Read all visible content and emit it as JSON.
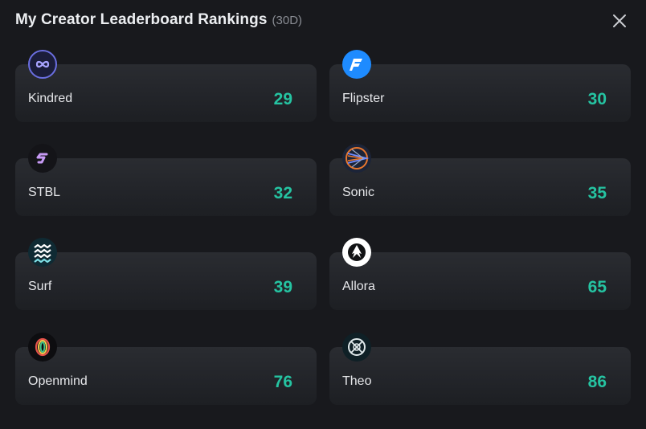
{
  "header": {
    "title": "My Creator Leaderboard Rankings",
    "period": "(30D)"
  },
  "close_icon": "close-icon",
  "colors": {
    "background": "#18191d",
    "card": "#26282d",
    "rank": "#25c4a2"
  },
  "rankings": [
    {
      "name": "Kindred",
      "rank": "29",
      "icon": "kindred-logo-icon"
    },
    {
      "name": "Flipster",
      "rank": "30",
      "icon": "flipster-logo-icon"
    },
    {
      "name": "STBL",
      "rank": "32",
      "icon": "stbl-logo-icon"
    },
    {
      "name": "Sonic",
      "rank": "35",
      "icon": "sonic-logo-icon"
    },
    {
      "name": "Surf",
      "rank": "39",
      "icon": "surf-logo-icon"
    },
    {
      "name": "Allora",
      "rank": "65",
      "icon": "allora-logo-icon"
    },
    {
      "name": "Openmind",
      "rank": "76",
      "icon": "openmind-logo-icon"
    },
    {
      "name": "Theo",
      "rank": "86",
      "icon": "theo-logo-icon"
    }
  ]
}
